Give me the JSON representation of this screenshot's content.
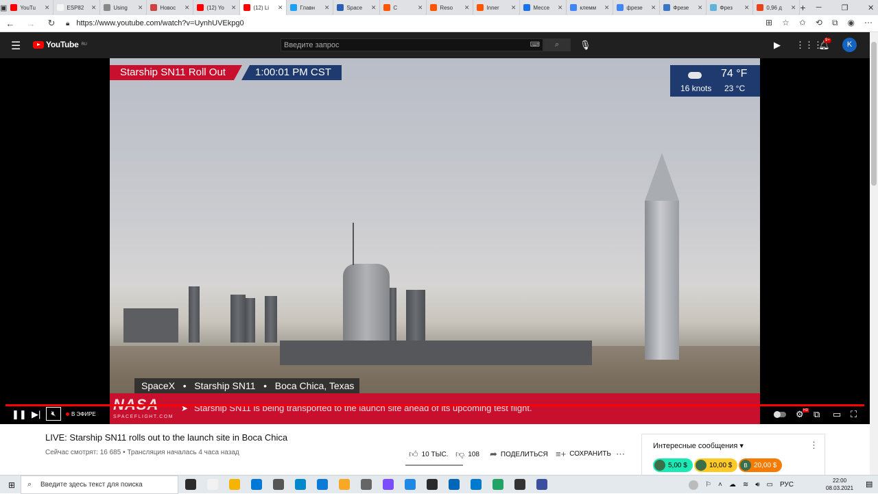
{
  "browser": {
    "tabs": [
      {
        "label": "YouTu",
        "color": "#ff0000",
        "active": false
      },
      {
        "label": "ESP82",
        "color": "#f5f5f5",
        "active": false
      },
      {
        "label": "Using",
        "color": "#888888",
        "active": false
      },
      {
        "label": "Новос",
        "color": "#c44",
        "active": false
      },
      {
        "label": "(12) Yo",
        "color": "#ff0000",
        "active": false
      },
      {
        "label": "(12) Li",
        "color": "#ff0000",
        "active": true
      },
      {
        "label": "Главн",
        "color": "#1da1f2",
        "active": false
      },
      {
        "label": "Space",
        "color": "#2b5fb4",
        "active": false
      },
      {
        "label": "C",
        "color": "#ff5500",
        "active": false
      },
      {
        "label": "Reso",
        "color": "#ff5500",
        "active": false
      },
      {
        "label": "Inner",
        "color": "#ff5500",
        "active": false
      },
      {
        "label": "Мессе",
        "color": "#1a73e8",
        "active": false
      },
      {
        "label": "клемм",
        "color": "#4285f4",
        "active": false
      },
      {
        "label": "фрезе",
        "color": "#4285f4",
        "active": false
      },
      {
        "label": "Фрезе",
        "color": "#3a76c2",
        "active": false
      },
      {
        "label": "Фрез",
        "color": "#5fb3d9",
        "active": false
      },
      {
        "label": "0,96 д",
        "color": "#e8431a",
        "active": false
      }
    ],
    "new_tab": "+",
    "window_controls": {
      "minimize": "─",
      "maximize": "❐",
      "close": "✕"
    },
    "url": "https://www.youtube.com/watch?v=UynhUVEkpg0"
  },
  "youtube": {
    "logo_text": "YouTube",
    "region": "RU",
    "search_placeholder": "Введите запрос",
    "avatar_letter": "K",
    "notifications": "9+"
  },
  "video": {
    "title_tag": "Starship SN11 Roll Out",
    "time_tag": "1:00:01 PM CST",
    "weather": {
      "temp_f": "74 °F",
      "temp_c": "23 °C",
      "wind": "16 knots"
    },
    "location_bar": "SpaceX   •   Starship SN11   •   Boca Chica, Texas",
    "ticker_brand": "NASA",
    "ticker_sub": "SPACEFLIGHT.COM",
    "ticker_text": "Starship SN11 is being transported to the launch site ahead of its upcoming test flight.",
    "live_label": "В ЭФИРЕ",
    "hd_badge": "HD"
  },
  "page": {
    "title": "LIVE: Starship SN11 rolls out to the launch site in Boca Chica",
    "meta": "Сейчас смотрят: 16 685 • Трансляция началась 4 часа назад",
    "likes": "10 ТЫС.",
    "dislikes": "108",
    "share": "ПОДЕЛИТЬСЯ",
    "save": "СОХРАНИТЬ",
    "chat_header": "Интересные сообщения",
    "superchats": [
      {
        "amount": "5,00 $",
        "color": "#1de9b6",
        "text_color": "#000000",
        "initial": ""
      },
      {
        "amount": "10,00 $",
        "color": "#ffca28",
        "text_color": "#000000",
        "initial": ""
      },
      {
        "amount": "20,00 $",
        "color": "#f57c00",
        "text_color": "#ffffff",
        "initial": "B"
      }
    ]
  },
  "taskbar": {
    "search_placeholder": "Введите здесь текст для поиска",
    "language": "РУС",
    "time": "22:00",
    "date": "08.03.2021",
    "icons": [
      "#2b2b2b",
      "#f2f2f2",
      "#f4b400",
      "#0078d7",
      "#555",
      "#0088cc",
      "#0a7bd6",
      "#f9a825",
      "#666",
      "#7c4dff",
      "#1e88e5",
      "#2a2a2a",
      "#0066b8",
      "#007acc",
      "#21a366",
      "#333",
      "#3c4f9e"
    ]
  }
}
